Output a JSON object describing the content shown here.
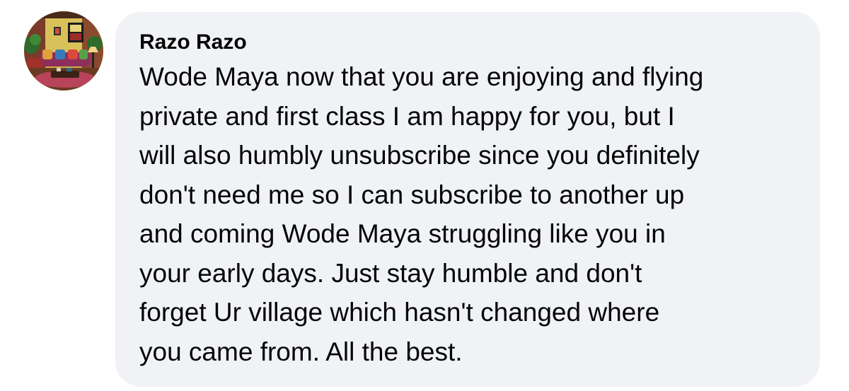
{
  "comment": {
    "author": "Razo Razo",
    "text": "Wode Maya now that you are enjoying and flying\nprivate and first class I am happy for you, but I\nwill also humbly unsubscribe since you definitely\ndon't need me so I can subscribe to another up\nand coming Wode Maya struggling like you in\nyour early days. Just stay humble and don't\nforget Ur village which hasn't changed where\nyou came from. All the best.",
    "avatar_icon": "profile-photo-living-room"
  },
  "colors": {
    "bubble_background": "#f0f2f5",
    "text": "#050505",
    "page_background": "#ffffff"
  }
}
